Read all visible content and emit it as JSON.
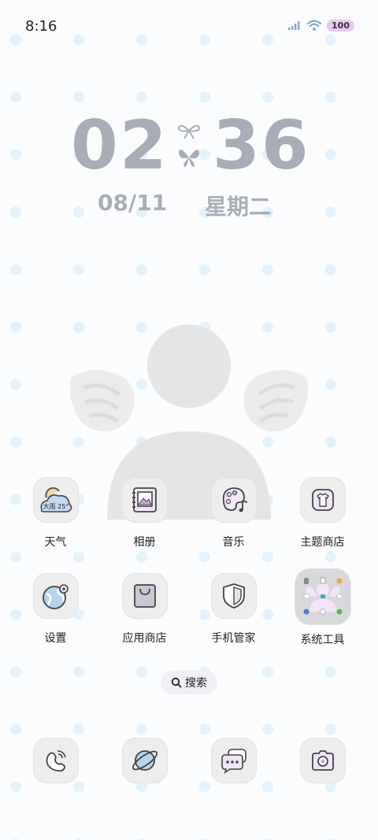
{
  "status_bar": {
    "time": "8:16",
    "battery": "100"
  },
  "lock_clock": {
    "hours": "02",
    "minutes": "36",
    "date": "08/11",
    "weekday": "星期二"
  },
  "apps": [
    {
      "label": "天气",
      "icon": "weather-icon",
      "badge": "大雨 25°"
    },
    {
      "label": "相册",
      "icon": "gallery-icon"
    },
    {
      "label": "音乐",
      "icon": "music-icon"
    },
    {
      "label": "主题商店",
      "icon": "theme-store-icon"
    },
    {
      "label": "设置",
      "icon": "settings-icon"
    },
    {
      "label": "应用商店",
      "icon": "app-store-icon"
    },
    {
      "label": "手机管家",
      "icon": "phone-manager-icon"
    },
    {
      "label": "系统工具",
      "icon": "system-tools-folder-icon"
    }
  ],
  "search": {
    "label": "搜索"
  },
  "dock": [
    {
      "icon": "phone-icon"
    },
    {
      "icon": "browser-icon"
    },
    {
      "icon": "messages-icon"
    },
    {
      "icon": "camera-icon"
    }
  ],
  "colors": {
    "clock": "#a9adb6",
    "accent_purple": "#c8a6dc",
    "accent_blue": "#b7d4ee",
    "icon_bg": "#ededee"
  }
}
